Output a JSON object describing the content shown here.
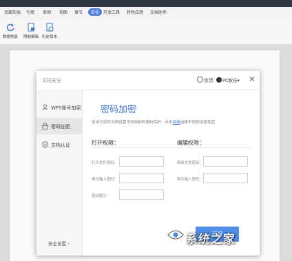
{
  "ribbon": {
    "tabs": [
      {
        "label": "页面布局"
      },
      {
        "label": "引用"
      },
      {
        "label": "审阅"
      },
      {
        "label": "视图"
      },
      {
        "label": "章节"
      },
      {
        "label": "安全"
      },
      {
        "label": "开发工具"
      },
      {
        "label": "特色应用"
      },
      {
        "label": "文档助手"
      }
    ],
    "active_tab": "安全",
    "tools": [
      {
        "label": "数据恢复",
        "icon": "restore-icon"
      },
      {
        "label": "限制编辑",
        "icon": "restrict-edit-icon"
      },
      {
        "label": "历史版本",
        "icon": "history-icon"
      }
    ]
  },
  "dialog": {
    "title": "文档安全",
    "feedback_label": "反馈",
    "user_label": "PC秋乐▾",
    "close_glyph": "✕",
    "sidebar": {
      "items": [
        {
          "label": "WPS账号加密",
          "icon": "user-icon"
        },
        {
          "label": "密码加密",
          "icon": "lock-icon"
        },
        {
          "label": "文档认证",
          "icon": "shield-icon"
        }
      ],
      "active": "密码加密",
      "bottom_label": "安全设置 ›"
    },
    "main": {
      "title": "密码加密",
      "description_before": "支持为您的文档设置不同级别的密码保护，点击",
      "description_link": "高级",
      "description_after": "选择不同的加密类型",
      "open_section": {
        "title": "打开权限：",
        "fields": [
          {
            "label": "打开文件密码：",
            "value": ""
          },
          {
            "label": "再次输入密码：",
            "value": ""
          },
          {
            "label": "密码提示：",
            "value": ""
          }
        ]
      },
      "edit_section": {
        "title": "编辑权限：",
        "fields": [
          {
            "label": "修改文件密码：",
            "value": ""
          },
          {
            "label": "再次输入密码：",
            "value": ""
          }
        ]
      },
      "apply_label": "应用"
    }
  },
  "watermark": {
    "text": "系统之家"
  },
  "colors": {
    "accent": "#3e77d8",
    "active_tab_bg": "#4e7fd9",
    "titlebar": "#2f3541",
    "button": "#4e8ce6"
  }
}
